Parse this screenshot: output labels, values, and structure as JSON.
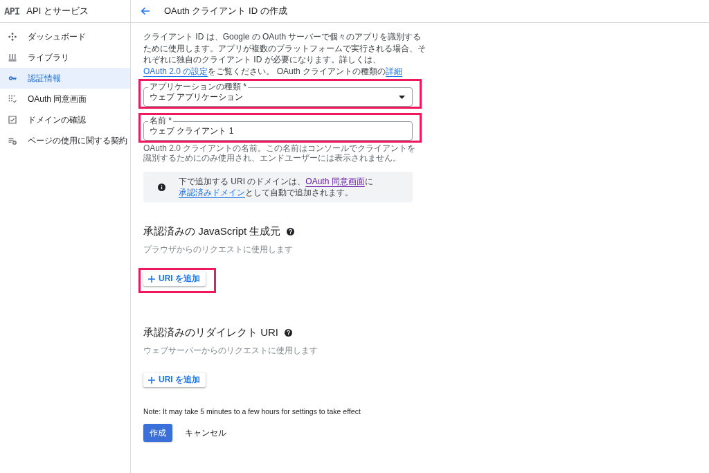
{
  "sidebar": {
    "logo": "API",
    "title": "API とサービス",
    "items": [
      {
        "label": "ダッシュボード",
        "selected": false
      },
      {
        "label": "ライブラリ",
        "selected": false
      },
      {
        "label": "認証情報",
        "selected": true
      },
      {
        "label": "OAuth 同意画面",
        "selected": false
      },
      {
        "label": "ドメインの確認",
        "selected": false
      },
      {
        "label": "ページの使用に関する契約",
        "selected": false
      }
    ]
  },
  "header": {
    "title": "OAuth クライアント ID の作成"
  },
  "intro": [
    {
      "kind": "text",
      "text": "クライアント ID は、Google の OAuth サーバーで個々のアプリを識別するために使用します。アプリが複数のプラットフォームで実行される場合、それぞれに独自のクライアント ID が必要になります。詳しくは、"
    },
    {
      "kind": "link",
      "text": "OAuth 2.0 の設定",
      "visited": false
    },
    {
      "kind": "text",
      "text": "をご覧ください。 OAuth クライアントの種類の"
    },
    {
      "kind": "link",
      "text": "詳細",
      "visited": false
    }
  ],
  "fields": [
    {
      "kind": "select",
      "label": "アプリケーションの種類 *",
      "value": "ウェブ アプリケーション",
      "highlighted": true
    },
    {
      "kind": "text",
      "label": "名前 *",
      "value": "ウェブ クライアント 1",
      "highlighted": true,
      "helper": "OAuth 2.0 クライアントの名前。この名前はコンソールでクライアントを識別するためにのみ使用され、エンドユーザーには表示されません。"
    }
  ],
  "notice": [
    {
      "kind": "text",
      "text": "下で追加する URI のドメインは、"
    },
    {
      "kind": "link",
      "text": "OAuth 同意画面",
      "visited": true
    },
    {
      "kind": "text",
      "text": "に"
    },
    {
      "kind": "link",
      "text": "承認済みドメイン",
      "visited": false
    },
    {
      "kind": "text",
      "text": "として自動で追加されます。"
    }
  ],
  "sections": [
    {
      "heading": "承認済みの JavaScript 生成元",
      "subtitle": "ブラウザからのリクエストに使用します",
      "add_button": {
        "label": "URI を追加",
        "highlighted": true
      }
    },
    {
      "heading": "承認済みのリダイレクト URI",
      "subtitle": "ウェブサーバーからのリクエストに使用します",
      "add_button": {
        "label": "URI を追加",
        "highlighted": false
      }
    }
  ],
  "note": "Note: It may take 5 minutes to a few hours for settings to take effect",
  "actions": [
    {
      "kind": "primary",
      "label": "作成"
    },
    {
      "kind": "text",
      "label": "キャンセル"
    }
  ]
}
